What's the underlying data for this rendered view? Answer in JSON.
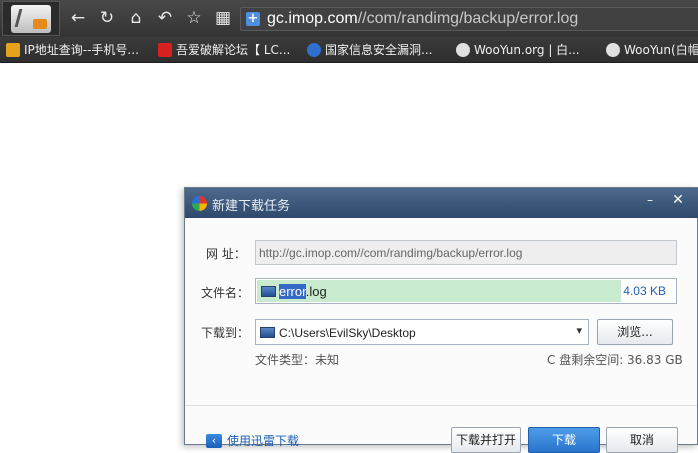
{
  "browser": {
    "address_url_domain": "gc.imop.com",
    "address_url_path": "//com/randimg/backup/error.log",
    "nav": [
      "back-icon",
      "refresh-icon",
      "home-icon",
      "undo-icon",
      "star-icon",
      "apps-icon"
    ],
    "nav_glyphs": [
      "←",
      "↻",
      "⌂",
      "↶",
      "☆",
      "▦"
    ],
    "bookmarks": [
      {
        "label": "IP地址查询--手机号...",
        "color": "#e6a21a"
      },
      {
        "label": "吾爱破解论坛【 LC...",
        "color": "#d92020"
      },
      {
        "label": "国家信息安全漏洞...",
        "color": "#2f6fd0"
      },
      {
        "label": "WooYun.org | 白...",
        "color": "#1a1a1a"
      },
      {
        "label": "WooYun(白帽",
        "color": "#1a1a1a"
      }
    ]
  },
  "dialog": {
    "title": "新建下载任务",
    "min_glyph": "–",
    "close_glyph": "✕",
    "url_label": "网  址：",
    "url_value": "http://gc.imop.com//com/randimg/backup/error.log",
    "filename_label": "文件名：",
    "filename_selected": "error",
    "filename_rest": ".log",
    "filesize": "4.03 KB",
    "dest_label": "下载到：",
    "dest_path": "C:\\Users\\EvilSky\\Desktop",
    "dest_arrow": "▾",
    "browse_label": "浏览...",
    "filetype_text": "文件类型：未知",
    "free_space_text": "C 盘剩余空间: 36.83 GB",
    "xunlei_link": "使用迅雷下载",
    "xunlei_glyph": "‹",
    "download_open_label": "下载并打开",
    "download_label": "下载",
    "cancel_label": "取消"
  }
}
